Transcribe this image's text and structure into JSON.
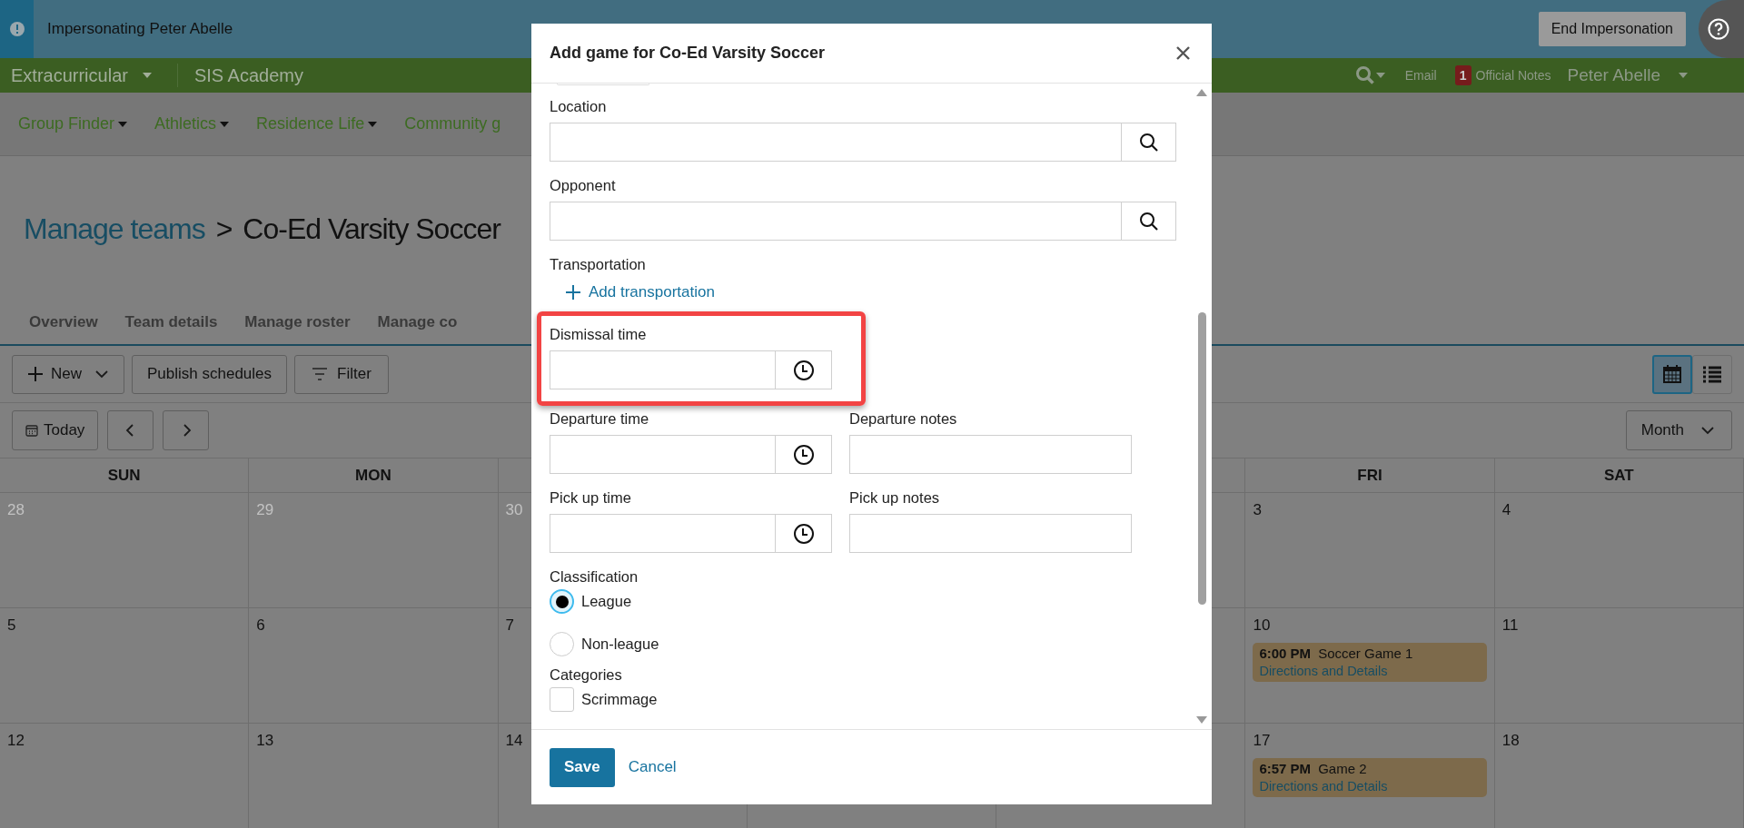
{
  "impersonation_bar": {
    "message": "Impersonating Peter Abelle",
    "button": "End Impersonation"
  },
  "top_nav": {
    "items": [
      {
        "label": "Extracurricular",
        "dropdown": true
      },
      {
        "label": "SIS Academy",
        "dropdown": false
      }
    ],
    "email": "Email",
    "notes_count": "1",
    "notes_label": "Official Notes",
    "user": "Peter Abelle"
  },
  "sub_nav": [
    {
      "label": "Group Finder",
      "dropdown": true
    },
    {
      "label": "Athletics",
      "dropdown": true
    },
    {
      "label": "Residence Life",
      "dropdown": true
    },
    {
      "label": "Community g",
      "dropdown": false
    }
  ],
  "page": {
    "breadcrumb_link": "Manage teams",
    "separator": ">",
    "title": "Co-Ed Varsity Soccer"
  },
  "tabs": [
    {
      "label": "Overview",
      "selected": false
    },
    {
      "label": "Team details",
      "selected": false
    },
    {
      "label": "Manage roster",
      "selected": false
    },
    {
      "label": "Manage co",
      "selected": false
    }
  ],
  "toolbar": {
    "new": "New",
    "publish": "Publish schedules",
    "filter": "Filter",
    "views": [
      {
        "kind": "calendar",
        "selected": true
      },
      {
        "kind": "list",
        "selected": false
      }
    ]
  },
  "date_nav": {
    "today": "Today",
    "period": "Month"
  },
  "calendar": {
    "columns_before_dialog": [
      {
        "header": "SUN",
        "days": [
          {
            "day": "28",
            "other_month": true
          },
          {
            "day": "5",
            "other_month": false
          },
          {
            "day": "12",
            "other_month": false
          }
        ]
      },
      {
        "header": "MON",
        "days": [
          {
            "day": "29",
            "other_month": true
          },
          {
            "day": "6",
            "other_month": false
          },
          {
            "day": "13",
            "other_month": false
          }
        ]
      },
      {
        "days": [
          {
            "day": "30",
            "other_month": true
          },
          {
            "day": "7",
            "other_month": false
          },
          {
            "day": "14",
            "other_month": false
          }
        ]
      }
    ],
    "columns_after_dialog": [
      {
        "header": "FRI",
        "days": [
          {
            "day": "3",
            "other_month": false
          },
          {
            "day": "10",
            "other_month": false,
            "events": [
              {
                "time": "6:00 PM",
                "title": "Soccer Game 1",
                "link": "Directions and Details"
              }
            ]
          },
          {
            "day": "17",
            "other_month": false,
            "events": [
              {
                "time": "6:57 PM",
                "title": "Game 2",
                "link": "Directions and Details"
              }
            ]
          }
        ]
      },
      {
        "header": "SAT",
        "days": [
          {
            "day": "4",
            "other_month": false
          },
          {
            "day": "11",
            "other_month": false
          },
          {
            "day": "18",
            "other_month": false
          }
        ]
      }
    ]
  },
  "dialog": {
    "title": "Add game for Co-Ed Varsity Soccer",
    "fields": [
      {
        "kind": "lookup",
        "label": "Location"
      },
      {
        "kind": "lookup",
        "label": "Opponent"
      },
      {
        "kind": "action",
        "label": "Transportation",
        "action": "Add transportation"
      },
      {
        "kind": "time",
        "label": "Dismissal time",
        "highlighted": true
      },
      {
        "kind": "time_notes",
        "time_label": "Departure time",
        "notes_label": "Departure notes"
      },
      {
        "kind": "time_notes",
        "time_label": "Pick up time",
        "notes_label": "Pick up notes"
      },
      {
        "kind": "radio",
        "label": "Classification",
        "options": [
          {
            "label": "League",
            "selected": true
          },
          {
            "label": "Non-league",
            "selected": false
          }
        ]
      },
      {
        "kind": "checkbox",
        "label": "Categories",
        "options": [
          {
            "label": "Scrimmage",
            "checked": false
          }
        ]
      }
    ],
    "save": "Save",
    "cancel": "Cancel"
  }
}
